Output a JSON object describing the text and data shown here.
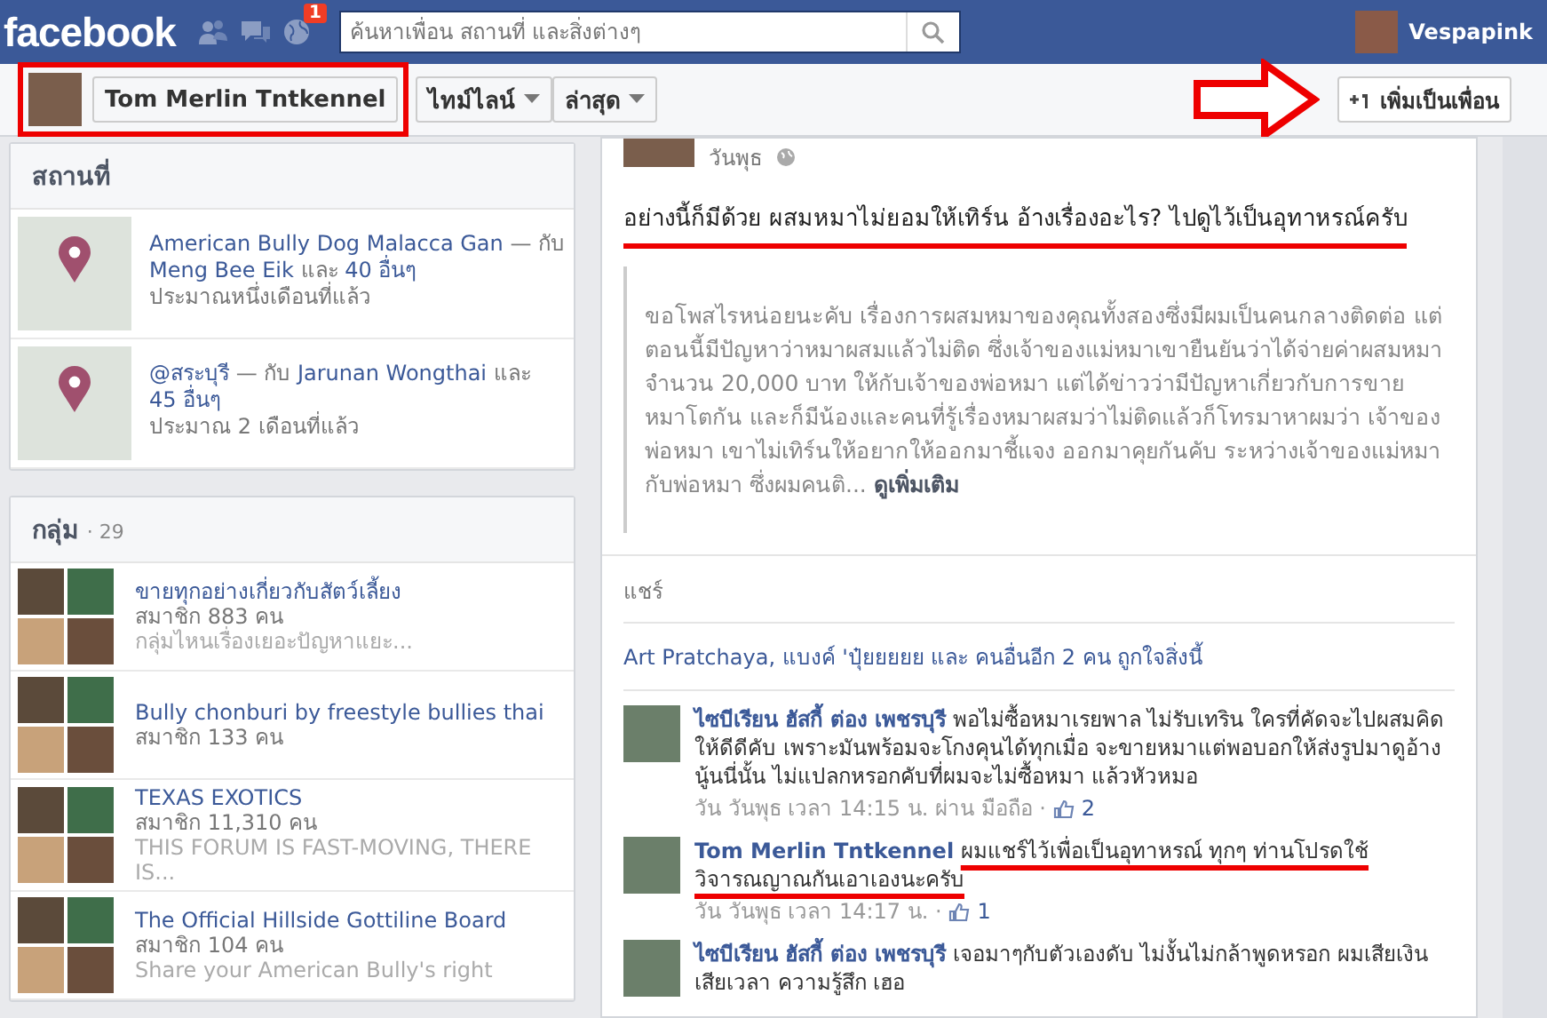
{
  "topbar": {
    "logo": "facebook",
    "notifications_badge": "1",
    "search": {
      "placeholder": "ค้นหาเพื่อน สถานที่ และสิ่งต่างๆ"
    },
    "user": "Vespapink"
  },
  "profile_header": {
    "name": "Tom Merlin Tntkennel",
    "highlighted": true,
    "menus": [
      {
        "label": "ไทม์ไลน์"
      },
      {
        "label": "ล่าสุด"
      }
    ],
    "add_friend": "เพิ่มเป็นเพื่อน",
    "arrow_to_add_friend": true
  },
  "places": {
    "title": "สถานที่",
    "items": [
      {
        "place": "American Bully Dog Malacca Gan",
        "with_prefix": "— กับ",
        "with": "Meng Bee Eik",
        "others_prefix": "และ",
        "others": "40 อื่นๆ",
        "time": "ประมาณหนึ่งเดือนที่แล้ว"
      },
      {
        "place": "@สระบุรี",
        "with_prefix": "— กับ",
        "with": "Jarunan Wongthai",
        "others_prefix": "และ",
        "others": "45 อื่นๆ",
        "time": "ประมาณ 2 เดือนที่แล้ว"
      }
    ]
  },
  "groups": {
    "title": "กลุ่ม",
    "count": "· 29",
    "items": [
      {
        "name": "ขายทุกอย่างเกี่ยวกับสัตว์เลี้ยง",
        "members": "สมาชิก 883 คน",
        "description": "กลุ่มไหนเรื่องเยอะปัญหาแยะ..."
      },
      {
        "name": "Bully chonburi by freestyle bullies thai",
        "members": "สมาชิก 133 คน"
      },
      {
        "name": "TEXAS EXOTICS",
        "members": "สมาชิก 11,310 คน",
        "description": "THIS FORUM IS FAST-MOVING, THERE IS..."
      },
      {
        "name": "The Official Hillside Gottiline Board",
        "members": "สมาชิก 104 คน",
        "description": "Share your American Bully's right"
      }
    ]
  },
  "post": {
    "date": "วันพุธ",
    "text": "อย่างนี้ก็มีด้วย ผสมหมาไม่ยอมให้เทิร์น อ้างเรื่องอะไร? ไปดูไว้เป็นอุทาหรณ์ครับ",
    "highlighted": true,
    "quote": "ขอโพสไรหน่อยนะคับ เรื่องการผสมหมาของคุณทั้งสองซึ่งมีผมเป็นคนกลางติดต่อ แต่ตอนนี้มีปัญหาว่าหมาผสมแล้วไม่ติด ซึ่งเจ้าของแม่หมาเขายืนยันว่าได้จ่ายค่าผสมหมาจำนวน 20,000 บาท ให้กับเจ้าของพ่อหมา แต่ได้ข่าวว่ามีปัญหาเกี่ยวกับการขายหมาโตกัน และก็มีน้องและคนที่รู้เรื่องหมาผสมว่าไม่ติดแล้วก็โทรมาหาผมว่า เจ้าของพ่อหมา เขาไม่เทิร์นให้อยากให้ออกมาชี้แจง ออกมาคุยกันคับ ระหว่างเจ้าของแม่หมากับพ่อหมา ซึ่งผมคนติ...",
    "see_more": "ดูเพิ่มเติม",
    "share": "แชร์",
    "likes": "Art Pratchaya, แบงค์ 'ปุ๋ยยยยย และ คนอื่นอีก 2 คน ถูกใจสิ่งนี้",
    "comments": [
      {
        "author": "ไซบีเรียน ฮัสกี้ ต่อง เพชรบุรี",
        "text": "พอไม่ซื้อหมาเรยพาล ไม่รับเทริน ใครที่คัดจะไปผสมคิดให้ดีดีคับ เพราะมันพร้อมจะโกงคุนได้ทุกเมื่อ จะขายหมาแต่พอบอกให้ส่งรูปมาดูอ้างนู้นนี่นั้น ไม่แปลกหรอกคับที่ผมจะไม่ซื้อหมา แล้วหัวหมอ",
        "meta": "วัน วันพุธ เวลา 14:15 น. ผ่าน มือถือ ·",
        "likes": "2",
        "highlighted": false
      },
      {
        "author": "Tom Merlin Tntkennel",
        "text": "ผมแชร์ไว้เพื่อเป็นอุทาหรณ์ ทุกๆ ท่านโปรดใช้วิจารณญาณกันเอาเองนะครับ",
        "meta": "วัน วันพุธ เวลา 14:17 น. ·",
        "likes": "1",
        "highlighted": true
      },
      {
        "author": "ไซบีเรียน ฮัสกี้ ต่อง เพชรบุรี",
        "text": "เจอมาๆกับตัวเองดับ ไม่งั้นไม่กล้าพูดหรอก ผมเสียเงิน เสียเวลา ความรู้สึก เฮอ",
        "highlighted": false
      }
    ]
  }
}
